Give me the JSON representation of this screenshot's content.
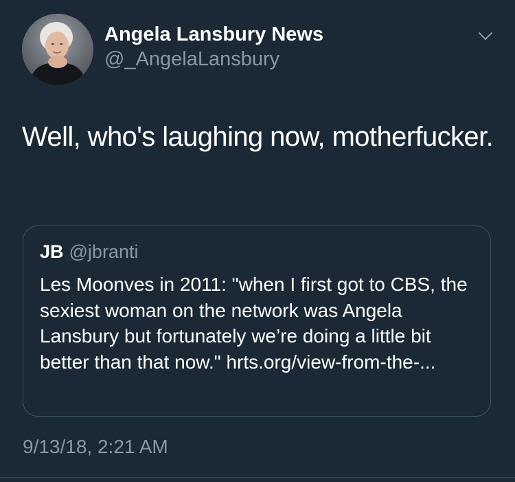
{
  "author": {
    "display_name": "Angela Lansbury News",
    "handle": "@_AngelaLansbury"
  },
  "icons": {
    "menu": "chevron-down-icon"
  },
  "tweet": {
    "text": "Well, who's laughing now, motherfucker.",
    "timestamp": "9/13/18, 2:21 AM"
  },
  "quoted_tweet": {
    "name": "JB",
    "handle": "@jbranti",
    "text": "Les Moonves in 2011: \"when I first got to CBS, the sexiest woman on the network was Angela Lansbury but fortunately we’re doing a little bit better than that now.\" hrts.org/view-from-the-..."
  },
  "colors": {
    "background": "#1b2836",
    "secondary_text": "#8899a6",
    "border": "#3d5466"
  }
}
